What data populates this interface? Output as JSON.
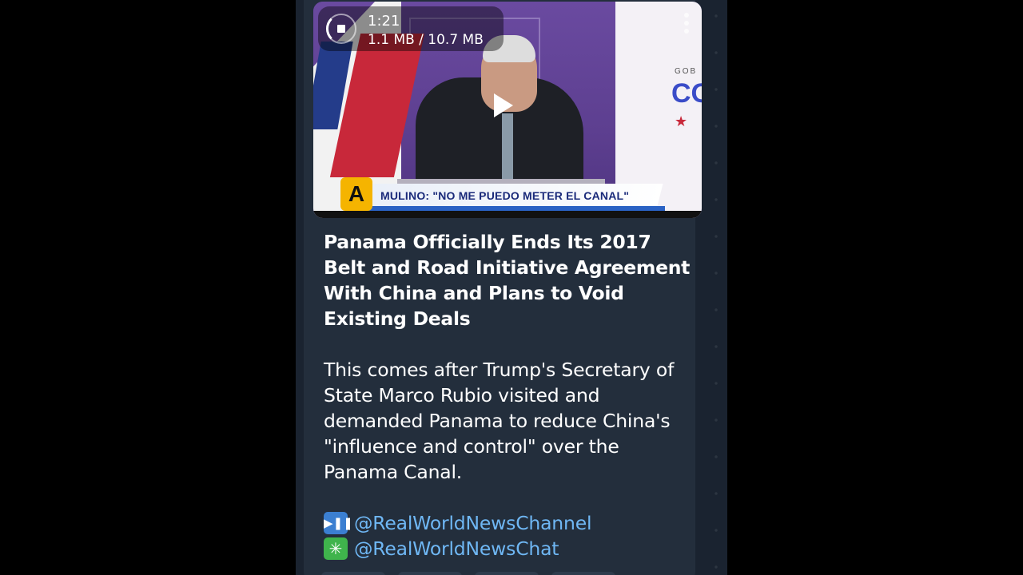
{
  "video": {
    "duration": "1:21",
    "download_progress": "1.1 MB / 10.7 MB",
    "banner_text": "MULINO: \"NO ME PUEDO METER EL CANAL\"",
    "channel_logo": "A",
    "panel_text_top": "GOB",
    "panel_text_big": "CO"
  },
  "post": {
    "title": "Panama Officially Ends Its 2017 Belt and Road Initiative Agreement With China and Plans to Void Existing Deals",
    "body": "This comes after Trump's Secretary of State Marco Rubio visited and demanded Panama to reduce China's \"influence and control\" over the Panama Canal.",
    "links": [
      {
        "icon": "play-pause-emoji-icon",
        "text": "@RealWorldNewsChannel"
      },
      {
        "icon": "eight-spoked-asterisk-emoji-icon",
        "text": "@RealWorldNewsChat"
      }
    ]
  },
  "colors": {
    "bubble": "#232e3c",
    "link": "#6fb7f4",
    "background": "#1a2330"
  }
}
